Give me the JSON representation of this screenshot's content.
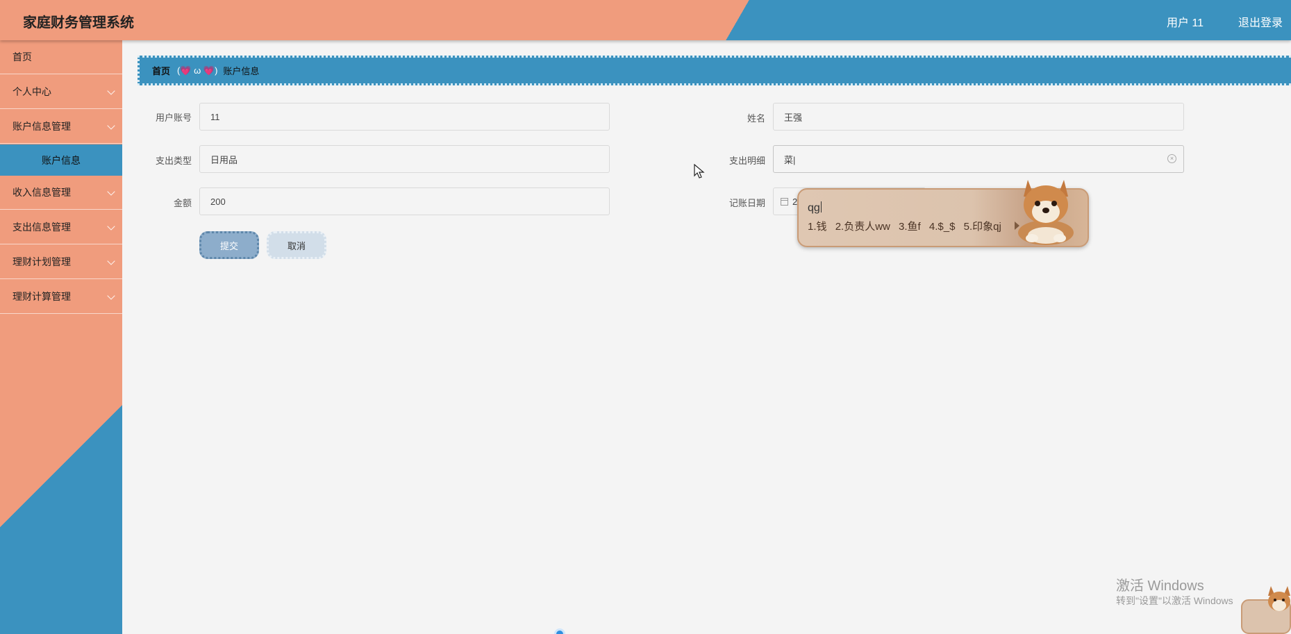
{
  "header": {
    "title": "家庭财务管理系统",
    "user_label": "用户 11",
    "logout_label": "退出登录"
  },
  "sidebar": {
    "items": [
      {
        "label": "首页"
      },
      {
        "label": "个人中心"
      },
      {
        "label": "账户信息管理"
      },
      {
        "label": "收入信息管理"
      },
      {
        "label": "支出信息管理"
      },
      {
        "label": "理财计划管理"
      },
      {
        "label": "理财计算管理"
      }
    ],
    "active_sub": "账户信息"
  },
  "breadcrumb": {
    "home": "首页",
    "separator": "(💗 ω 💗)",
    "current": "账户信息"
  },
  "form": {
    "account_label": "用户账号",
    "account_value": "11",
    "name_label": "姓名",
    "name_value": "王强",
    "type_label": "支出类型",
    "type_value": "日用品",
    "detail_label": "支出明细",
    "detail_value": "菜|",
    "amount_label": "金额",
    "amount_value": "200",
    "date_label": "记账日期",
    "date_value": "2",
    "submit_label": "提交",
    "cancel_label": "取消"
  },
  "ime": {
    "typed": "qg",
    "candidates": [
      "1.钱",
      "2.负责人ww",
      "3.鱼f",
      "4.$_$",
      "5.印象qj"
    ]
  },
  "watermark": {
    "line1": "激活 Windows",
    "line2": "转到\"设置\"以激活 Windows"
  },
  "colors": {
    "accent_orange": "#f09c7d",
    "accent_blue": "#3b92bf"
  }
}
